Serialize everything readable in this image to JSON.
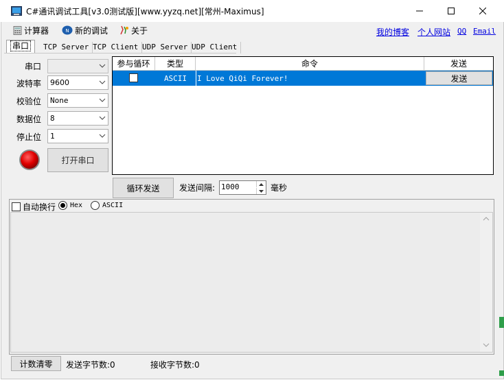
{
  "window": {
    "title": "C#通讯调试工具[v3.0测试版][www.yyzq.net][常州-Maximus]"
  },
  "menu": {
    "calculator": "计算器",
    "new_debug": "新的调试",
    "about": "关于",
    "links": [
      "我的博客",
      "个人网站",
      "QQ",
      "Email"
    ]
  },
  "tabs": [
    "串口",
    "TCP Server",
    "TCP Client",
    "UDP Server",
    "UDP Client"
  ],
  "serial": {
    "labels": [
      "串口",
      "波特率",
      "校验位",
      "数据位",
      "停止位"
    ],
    "values": [
      "",
      "9600",
      "None",
      "8",
      "1"
    ],
    "open_button": "打开串口"
  },
  "command_table": {
    "headers": [
      "参与循环",
      "类型",
      "命令",
      "发送"
    ],
    "rows": [
      {
        "loop": false,
        "type": "ASCII",
        "command": "I Love QiQi Forever!",
        "send_label": "发送"
      }
    ]
  },
  "cycle": {
    "cycle_send_button": "循环发送",
    "interval_label": "发送间隔:",
    "interval_value": "1000",
    "unit": "毫秒"
  },
  "receive": {
    "auto_wrap": "自动换行",
    "hex": "Hex",
    "ascii": "ASCII",
    "selected_mode": "Hex"
  },
  "status": {
    "reset_button": "计数清零",
    "sent_bytes": "发送字节数:0",
    "recv_bytes": "接收字节数:0"
  },
  "colors": {
    "selection": "#0078d7",
    "link": "#0000e0",
    "status_led": "#e00000"
  }
}
